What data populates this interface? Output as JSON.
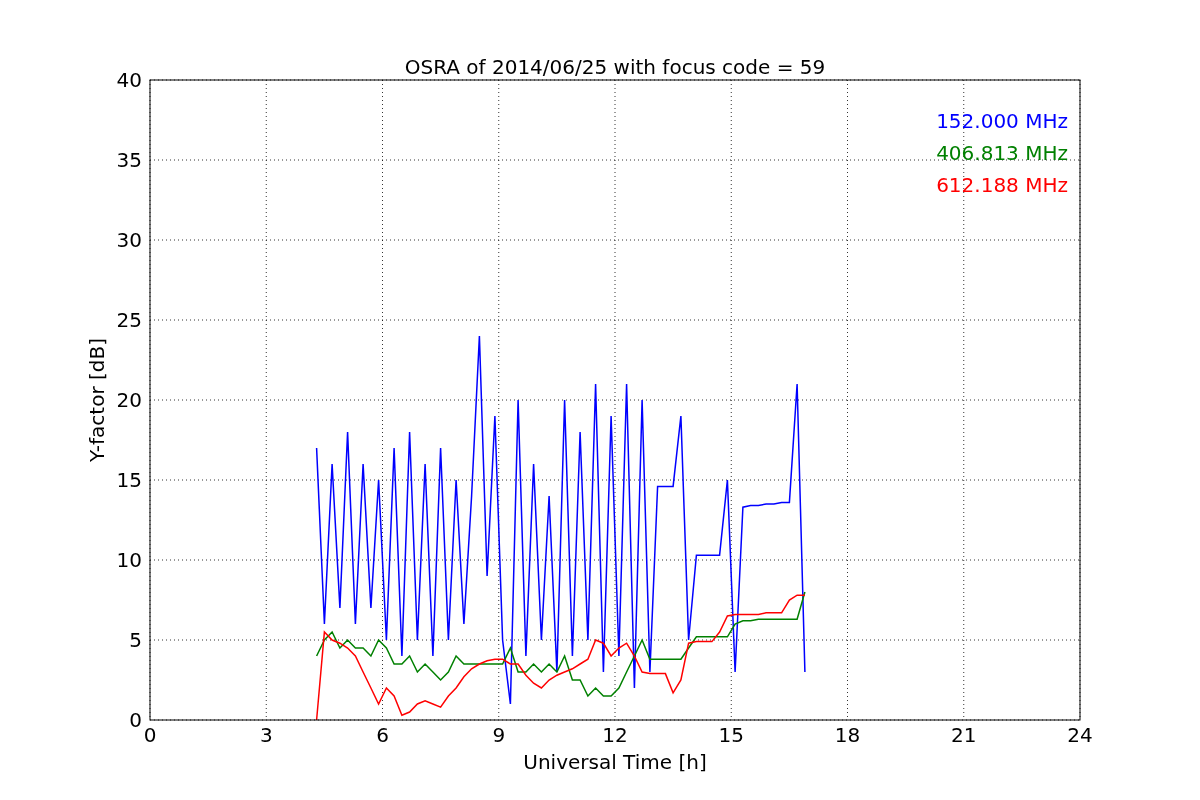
{
  "chart_data": {
    "type": "line",
    "title": "OSRA of 2014/06/25 with focus code = 59",
    "xlabel": "Universal Time [h]",
    "ylabel": "Y-factor [dB]",
    "x": [
      4.3,
      4.5,
      4.7,
      4.9,
      5.1,
      5.3,
      5.5,
      5.7,
      5.9,
      6.1,
      6.3,
      6.5,
      6.7,
      6.9,
      7.1,
      7.3,
      7.5,
      7.7,
      7.9,
      8.1,
      8.3,
      8.5,
      8.7,
      8.9,
      9.1,
      9.3,
      9.5,
      9.7,
      9.9,
      10.1,
      10.3,
      10.5,
      10.7,
      10.9,
      11.1,
      11.3,
      11.5,
      11.7,
      11.9,
      12.1,
      12.3,
      12.5,
      12.7,
      12.9,
      13.1,
      13.3,
      13.5,
      13.7,
      13.9,
      14.1,
      14.3,
      14.5,
      14.7,
      14.9,
      15.1,
      15.3,
      15.5,
      15.7,
      15.9,
      16.1,
      16.3,
      16.5,
      16.7,
      16.9
    ],
    "series": [
      {
        "name": "152.000 MHz",
        "color": "#0000ff",
        "values": [
          17,
          6,
          16,
          7,
          18,
          6,
          16,
          7,
          15,
          5,
          17,
          4,
          18,
          5,
          16,
          4,
          17,
          5,
          15,
          6,
          14,
          24,
          9,
          19,
          5,
          1,
          20,
          4,
          16,
          5,
          14,
          3,
          20,
          4,
          18,
          5,
          21,
          3,
          19,
          4,
          21,
          2,
          20,
          3,
          14.6,
          14.6,
          14.6,
          19,
          5,
          10.3,
          10.3,
          10.3,
          10.3,
          15,
          3,
          13.3,
          13.4,
          13.4,
          13.5,
          13.5,
          13.6,
          13.6,
          21,
          3
        ]
      },
      {
        "name": "406.813 MHz",
        "color": "#008000",
        "values": [
          4,
          5,
          5.5,
          4.5,
          5,
          4.5,
          4.5,
          4,
          5,
          4.5,
          3.5,
          3.5,
          4,
          3,
          3.5,
          3,
          2.5,
          3,
          4,
          3.5,
          3.5,
          3.5,
          3.5,
          3.5,
          3.5,
          4.5,
          3,
          3,
          3.5,
          3,
          3.5,
          3,
          4,
          2.5,
          2.5,
          1.5,
          2,
          1.5,
          1.5,
          2,
          3,
          4,
          5,
          3.8,
          3.8,
          3.8,
          3.8,
          3.8,
          4.5,
          5.2,
          5.2,
          5.2,
          5.2,
          5.2,
          6,
          6.2,
          6.2,
          6.3,
          6.3,
          6.3,
          6.3,
          6.3,
          6.3,
          8
        ]
      },
      {
        "name": "612.188 MHz",
        "color": "#ff0000",
        "values": [
          0,
          5.5,
          5,
          4.8,
          4.5,
          4,
          3,
          2,
          1,
          2,
          1.5,
          0.3,
          0.5,
          1,
          1.2,
          1,
          0.8,
          1.5,
          2,
          2.7,
          3.2,
          3.5,
          3.7,
          3.8,
          3.8,
          3.5,
          3.5,
          2.8,
          2.3,
          2,
          2.5,
          2.8,
          3,
          3.2,
          3.5,
          3.8,
          5,
          4.8,
          4,
          4.5,
          4.8,
          4,
          3,
          2.9,
          2.9,
          2.9,
          1.7,
          2.5,
          4.8,
          4.9,
          4.9,
          4.9,
          5.5,
          6.5,
          6.6,
          6.6,
          6.6,
          6.6,
          6.7,
          6.7,
          6.7,
          7.5,
          7.8,
          7.8
        ]
      }
    ],
    "xlim": [
      0,
      24
    ],
    "ylim": [
      0,
      40
    ],
    "xticks": [
      0,
      3,
      6,
      9,
      12,
      15,
      18,
      21,
      24
    ],
    "yticks": [
      0,
      5,
      10,
      15,
      20,
      25,
      30,
      35,
      40
    ],
    "grid": true
  }
}
